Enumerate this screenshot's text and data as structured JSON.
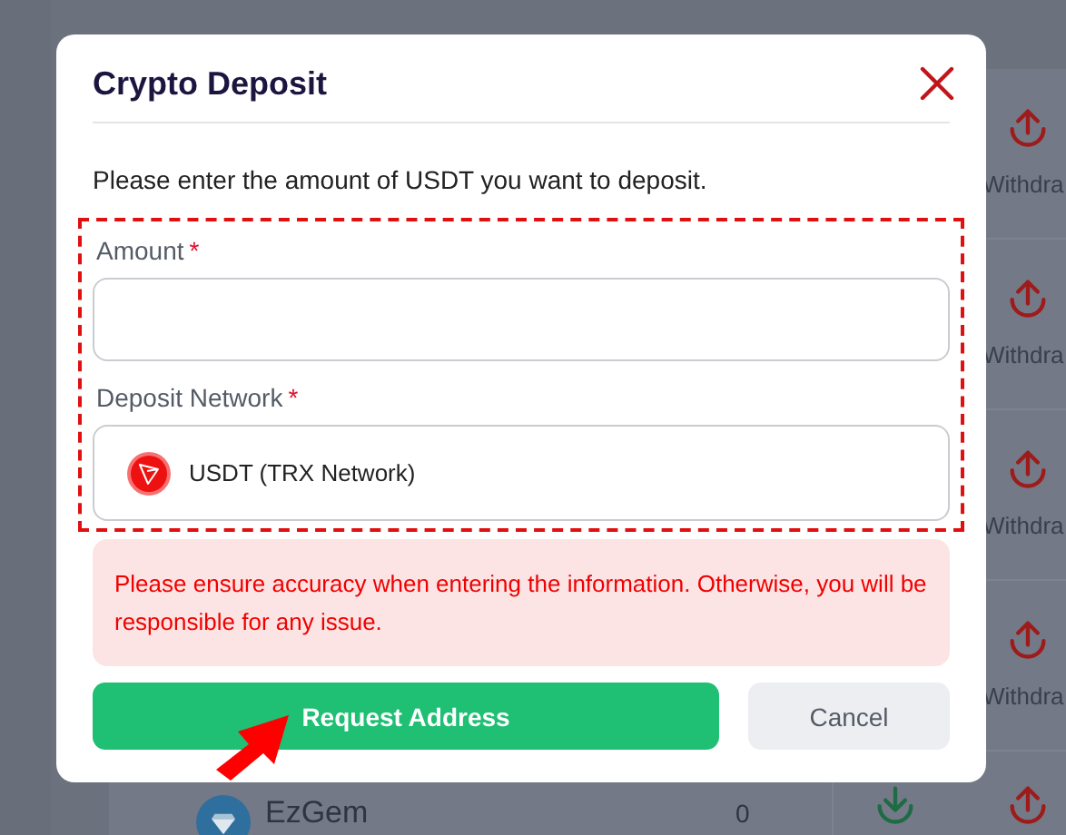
{
  "background": {
    "rows": [
      {
        "actions": [
          {
            "kind": "withdraw",
            "label": "Withdra"
          }
        ]
      },
      {
        "actions": [
          {
            "kind": "withdraw",
            "label": "Withdra"
          }
        ]
      },
      {
        "actions": [
          {
            "kind": "withdraw",
            "label": "Withdra"
          }
        ]
      },
      {
        "actions": [
          {
            "kind": "withdraw",
            "label": "Withdra"
          }
        ]
      },
      {
        "name": "EzGem",
        "amount": "0",
        "actions": [
          {
            "kind": "deposit"
          },
          {
            "kind": "withdraw"
          }
        ]
      }
    ]
  },
  "modal": {
    "title": "Crypto Deposit",
    "instruction": "Please enter the amount of USDT you want to deposit.",
    "fields": [
      {
        "kind": "input",
        "label": "Amount",
        "required_mark": "*"
      },
      {
        "kind": "select",
        "label": "Deposit Network",
        "required_mark": "*",
        "value": "USDT (TRX Network)"
      }
    ],
    "warning": "Please ensure accuracy when entering the information. Otherwise, you will be responsible for any issue.",
    "buttons": [
      {
        "kind": "primary",
        "label": "Request Address"
      },
      {
        "kind": "secondary",
        "label": "Cancel"
      }
    ]
  }
}
